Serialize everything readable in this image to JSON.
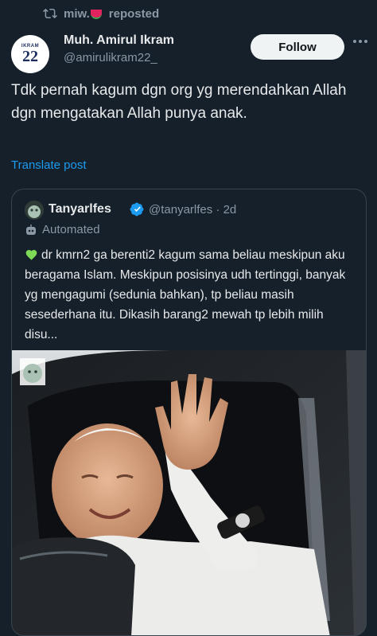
{
  "repost": {
    "user": "miw.",
    "label": "reposted",
    "icon": "repost-icon"
  },
  "author": {
    "avatar_top": "IKRAM",
    "avatar_number": "22",
    "name": "Muh. Amirul Ikram",
    "handle": "@amirulikram22_"
  },
  "actions": {
    "follow_label": "Follow",
    "more_icon": "more-horizontal-icon"
  },
  "post": {
    "text": "Tdk pernah kagum dgn org yg merendahkan Allah dgn mengatakan Allah punya anak.",
    "translate_label": "Translate post"
  },
  "quote": {
    "name": "Tanyarlfes",
    "handle": "@tanyarlfes · 2d",
    "automated_label": "Automated",
    "text": "dr kmrn2 ga berenti2 kagum sama beliau meskipun aku beragama Islam. Meskipun posisinya udh tertinggi, banyak yg mengagumi (sedunia bahkan), tp beliau masih sesederhana itu. Dikasih barang2 mewah tp lebih milih disu..."
  },
  "colors": {
    "background": "#15202b",
    "accent": "#1d9bf0",
    "muted": "#8b98a5",
    "heart": "#7ed957"
  }
}
